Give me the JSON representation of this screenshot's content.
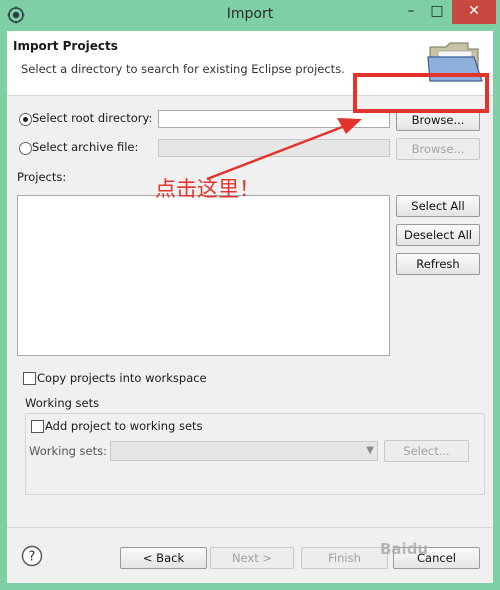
{
  "window": {
    "title": "Import",
    "buttons": {
      "minimize": "–",
      "maximize": "□",
      "close": "✕"
    }
  },
  "header": {
    "title": "Import Projects",
    "description": "Select a directory to search for existing Eclipse projects.",
    "icon": "folder-open-icon"
  },
  "source": {
    "root_directory": {
      "label": "Select root directory:",
      "value": "",
      "selected": true,
      "browse_label": "Browse..."
    },
    "archive_file": {
      "label": "Select archive file:",
      "value": "",
      "selected": false,
      "browse_label": "Browse..."
    }
  },
  "projects": {
    "label": "Projects:",
    "items": [],
    "buttons": {
      "select_all": "Select All",
      "deselect_all": "Deselect All",
      "refresh": "Refresh"
    }
  },
  "options": {
    "copy_projects": {
      "label": "Copy projects into workspace",
      "checked": false
    }
  },
  "working_sets": {
    "group_label": "Working sets",
    "add_label": "Add project to working sets",
    "add_checked": false,
    "field_label": "Working sets:",
    "field_value": "",
    "select_button": "Select..."
  },
  "footer": {
    "help_icon": "help-icon",
    "back": "< Back",
    "next": "Next >",
    "finish": "Finish",
    "cancel": "Cancel"
  },
  "annotation": {
    "text": "点击这里！",
    "color": "#e3332c"
  },
  "watermark": {
    "text": "Baidu"
  },
  "colors": {
    "window_frame": "#7fcfa4",
    "close_button": "#c7483f",
    "dialog_bg": "#f0f0f0"
  }
}
